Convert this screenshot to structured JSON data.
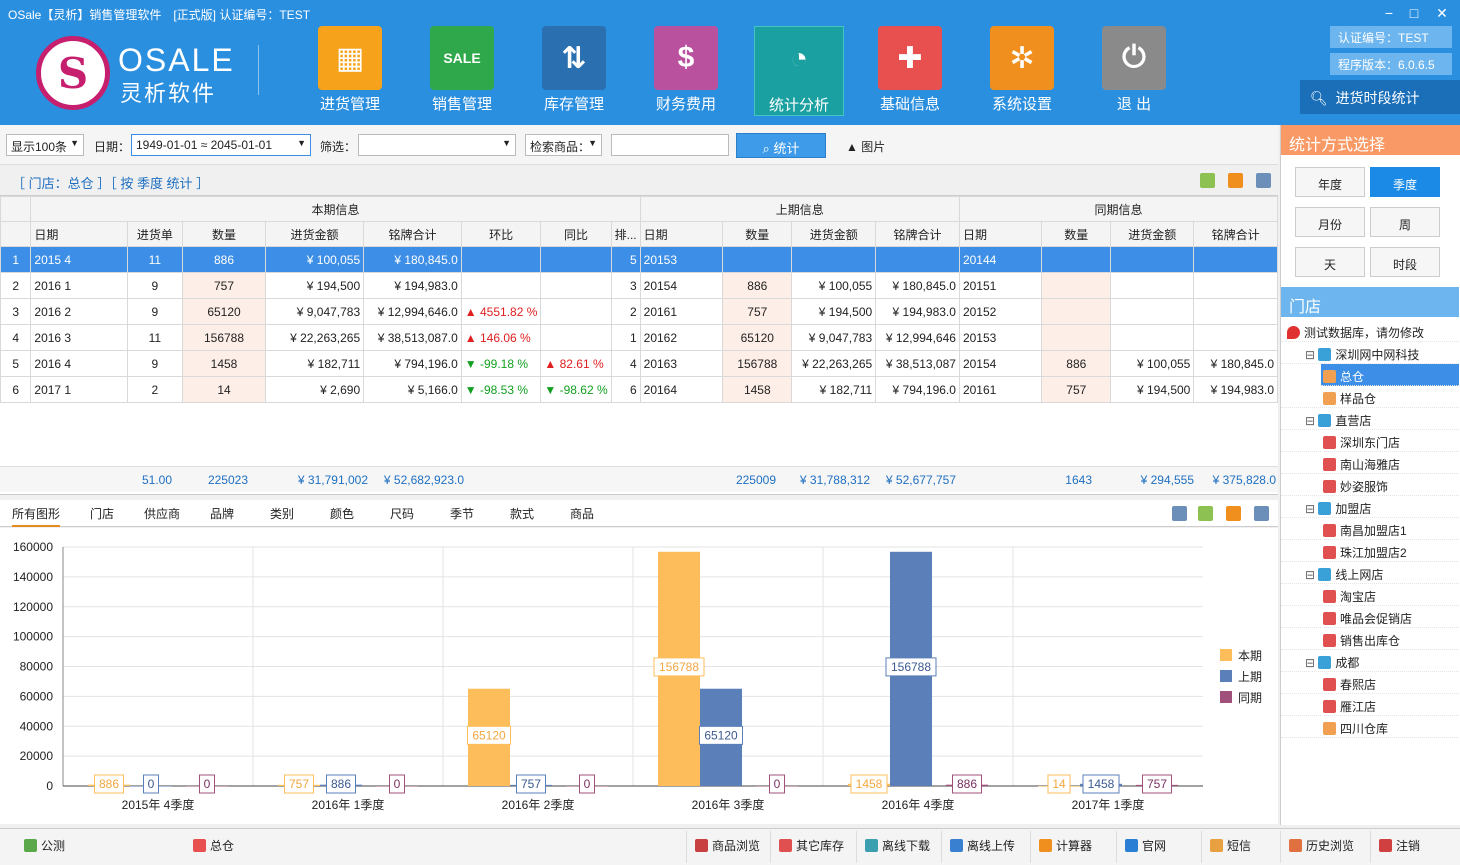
{
  "window": {
    "title": "OSale【灵析】销售管理软件　[正式版]  认证编号：TEST",
    "min": "−",
    "max": "□",
    "close": "✕"
  },
  "logo": {
    "brand": "OSALE",
    "sub": "灵析软件"
  },
  "nav": [
    {
      "label": "进货管理",
      "color": "#f7a21b",
      "glyph": "▦"
    },
    {
      "label": "销售管理",
      "color": "#2ea84a",
      "glyph": "SALE"
    },
    {
      "label": "库存管理",
      "color": "#2a6fb0",
      "glyph": "⇅"
    },
    {
      "label": "财务费用",
      "color": "#b9519f",
      "glyph": "$"
    },
    {
      "label": "统计分析",
      "color": "#1aa0a0",
      "glyph": "◔"
    },
    {
      "label": "基础信息",
      "color": "#e85050",
      "glyph": "✚"
    },
    {
      "label": "系统设置",
      "color": "#f08f1e",
      "glyph": "✲"
    },
    {
      "label": "退  出",
      "color": "#8a8a8a",
      "glyph": "⏻"
    }
  ],
  "info": {
    "cert": "认证编号：TEST",
    "version": "程序版本：6.0.6.5",
    "period": "进货时段统计"
  },
  "toolbar": {
    "show": "显示100条",
    "date_label": "日期：",
    "date_value": "1949-01-01 ≈ 2045-01-01",
    "filter_label": "筛选：",
    "search_goods": "检索商品：",
    "stat_btn": "统计",
    "image_btn": "图片"
  },
  "crumbs": "［ 门店：总仓 ］［ 按 季度 统计 ］",
  "groups": {
    "current": "本期信息",
    "prev": "上期信息",
    "same": "同期信息"
  },
  "headers": [
    "日期",
    "进货单",
    "数量",
    "进货金额",
    "铭牌合计",
    "环比",
    "同比",
    "排...",
    "日期",
    "数量",
    "进货金额",
    "铭牌合计",
    "日期",
    "数量",
    "进货金额",
    "铭牌合计"
  ],
  "rows": [
    {
      "n": "1",
      "d": "2015 4",
      "o": "11",
      "q": "886",
      "a": "¥ 100,055",
      "t": "¥ 180,845.0",
      "hb": "",
      "tb": "",
      "rk": "5",
      "pd": "20153",
      "pq": "",
      "pa": "",
      "pt": "",
      "sd": "20144",
      "sq": "",
      "sa": "",
      "st": ""
    },
    {
      "n": "2",
      "d": "2016 1",
      "o": "9",
      "q": "757",
      "a": "¥ 194,500",
      "t": "¥ 194,983.0",
      "hb": "",
      "tb": "",
      "rk": "3",
      "pd": "20154",
      "pq": "886",
      "pa": "¥ 100,055",
      "pt": "¥ 180,845.0",
      "sd": "20151",
      "sq": "",
      "sa": "",
      "st": ""
    },
    {
      "n": "3",
      "d": "2016 2",
      "o": "9",
      "q": "65120",
      "a": "¥ 9,047,783",
      "t": "¥ 12,994,646.0",
      "hb": "4551.82 %",
      "hbdir": "up",
      "tb": "",
      "rk": "2",
      "pd": "20161",
      "pq": "757",
      "pa": "¥ 194,500",
      "pt": "¥ 194,983.0",
      "sd": "20152",
      "sq": "",
      "sa": "",
      "st": ""
    },
    {
      "n": "4",
      "d": "2016 3",
      "o": "11",
      "q": "156788",
      "a": "¥ 22,263,265",
      "t": "¥ 38,513,087.0",
      "hb": "146.06 %",
      "hbdir": "up",
      "tb": "",
      "rk": "1",
      "pd": "20162",
      "pq": "65120",
      "pa": "¥ 9,047,783",
      "pt": "¥ 12,994,646",
      "sd": "20153",
      "sq": "",
      "sa": "",
      "st": ""
    },
    {
      "n": "5",
      "d": "2016 4",
      "o": "9",
      "q": "1458",
      "a": "¥ 182,711",
      "t": "¥ 794,196.0",
      "hb": "-99.18 %",
      "hbdir": "dn",
      "tb": "82.61 %",
      "tbdir": "up",
      "rk": "4",
      "pd": "20163",
      "pq": "156788",
      "pa": "¥ 22,263,265",
      "pt": "¥ 38,513,087",
      "sd": "20154",
      "sq": "886",
      "sa": "¥ 100,055",
      "st": "¥ 180,845.0"
    },
    {
      "n": "6",
      "d": "2017 1",
      "o": "2",
      "q": "14",
      "a": "¥ 2,690",
      "t": "¥ 5,166.0",
      "hb": "-98.53 %",
      "hbdir": "dn",
      "tb": "-98.62 %",
      "tbdir": "dn",
      "rk": "6",
      "pd": "20164",
      "pq": "1458",
      "pa": "¥ 182,711",
      "pt": "¥ 794,196.0",
      "sd": "20161",
      "sq": "757",
      "sa": "¥ 194,500",
      "st": "¥ 194,983.0"
    }
  ],
  "totals": {
    "o": "51.00",
    "q": "225023",
    "a": "¥ 31,791,002",
    "t": "¥ 52,682,923.0",
    "pq": "225009",
    "pa": "¥ 31,788,312",
    "pt": "¥ 52,677,757",
    "sq": "1643",
    "sa": "¥ 294,555",
    "st": "¥ 375,828.0"
  },
  "chart_tabs": [
    "所有图形",
    "门店",
    "供应商",
    "品牌",
    "类别",
    "颜色",
    "尺码",
    "季节",
    "款式",
    "商品"
  ],
  "chart_data": {
    "type": "bar",
    "categories": [
      "2015年 4季度",
      "2016年 1季度",
      "2016年 2季度",
      "2016年 3季度",
      "2016年 4季度",
      "2017年 1季度"
    ],
    "series": [
      {
        "name": "本期",
        "color": "#fdbd5b",
        "values": [
          886,
          757,
          65120,
          156788,
          1458,
          14
        ]
      },
      {
        "name": "上期",
        "color": "#5b7fb8",
        "values": [
          0,
          886,
          757,
          65120,
          156788,
          1458
        ]
      },
      {
        "name": "同期",
        "color": "#a0507a",
        "values": [
          0,
          0,
          0,
          0,
          886,
          757
        ]
      }
    ],
    "ylim": [
      0,
      160000
    ],
    "yticks": [
      "160000",
      "140000",
      "120000",
      "100000",
      "80000",
      "60000",
      "40000",
      "20000",
      "0"
    ],
    "legend": "right"
  },
  "rpanel": {
    "title": "统计方式选择",
    "periods": [
      "年度",
      "季度",
      "月份",
      "周",
      "天",
      "时段"
    ],
    "store_title": "门店"
  },
  "tree": [
    {
      "label": "测试数据库，请勿修改",
      "lvl": 0,
      "icon": "pin"
    },
    {
      "label": "深圳网中网科技",
      "lvl": 1,
      "icon": "org"
    },
    {
      "label": "总仓",
      "lvl": 2,
      "icon": "wh",
      "hl": true
    },
    {
      "label": "样品仓",
      "lvl": 2,
      "icon": "wh"
    },
    {
      "label": "直营店",
      "lvl": 1,
      "icon": "org"
    },
    {
      "label": "深圳东门店",
      "lvl": 2,
      "icon": "home"
    },
    {
      "label": "南山海雅店",
      "lvl": 2,
      "icon": "home"
    },
    {
      "label": "妙姿服饰",
      "lvl": 2,
      "icon": "home"
    },
    {
      "label": "加盟店",
      "lvl": 1,
      "icon": "org"
    },
    {
      "label": "南昌加盟店1",
      "lvl": 2,
      "icon": "home"
    },
    {
      "label": "珠江加盟店2",
      "lvl": 2,
      "icon": "home"
    },
    {
      "label": "线上网店",
      "lvl": 1,
      "icon": "org"
    },
    {
      "label": "淘宝店",
      "lvl": 2,
      "icon": "home"
    },
    {
      "label": "唯品会促销店",
      "lvl": 2,
      "icon": "home"
    },
    {
      "label": "销售出库仓",
      "lvl": 2,
      "icon": "home"
    },
    {
      "label": "成都",
      "lvl": 1,
      "icon": "org"
    },
    {
      "label": "春熙店",
      "lvl": 2,
      "icon": "home"
    },
    {
      "label": "雁江店",
      "lvl": 2,
      "icon": "home"
    },
    {
      "label": "四川仓库",
      "lvl": 2,
      "icon": "wh"
    }
  ],
  "status": {
    "mode": "公测",
    "store": "总仓",
    "buttons": [
      "商品浏览",
      "其它库存",
      "离线下载",
      "离线上传",
      "计算器",
      "官网",
      "短信",
      "历史浏览",
      "注销"
    ]
  }
}
